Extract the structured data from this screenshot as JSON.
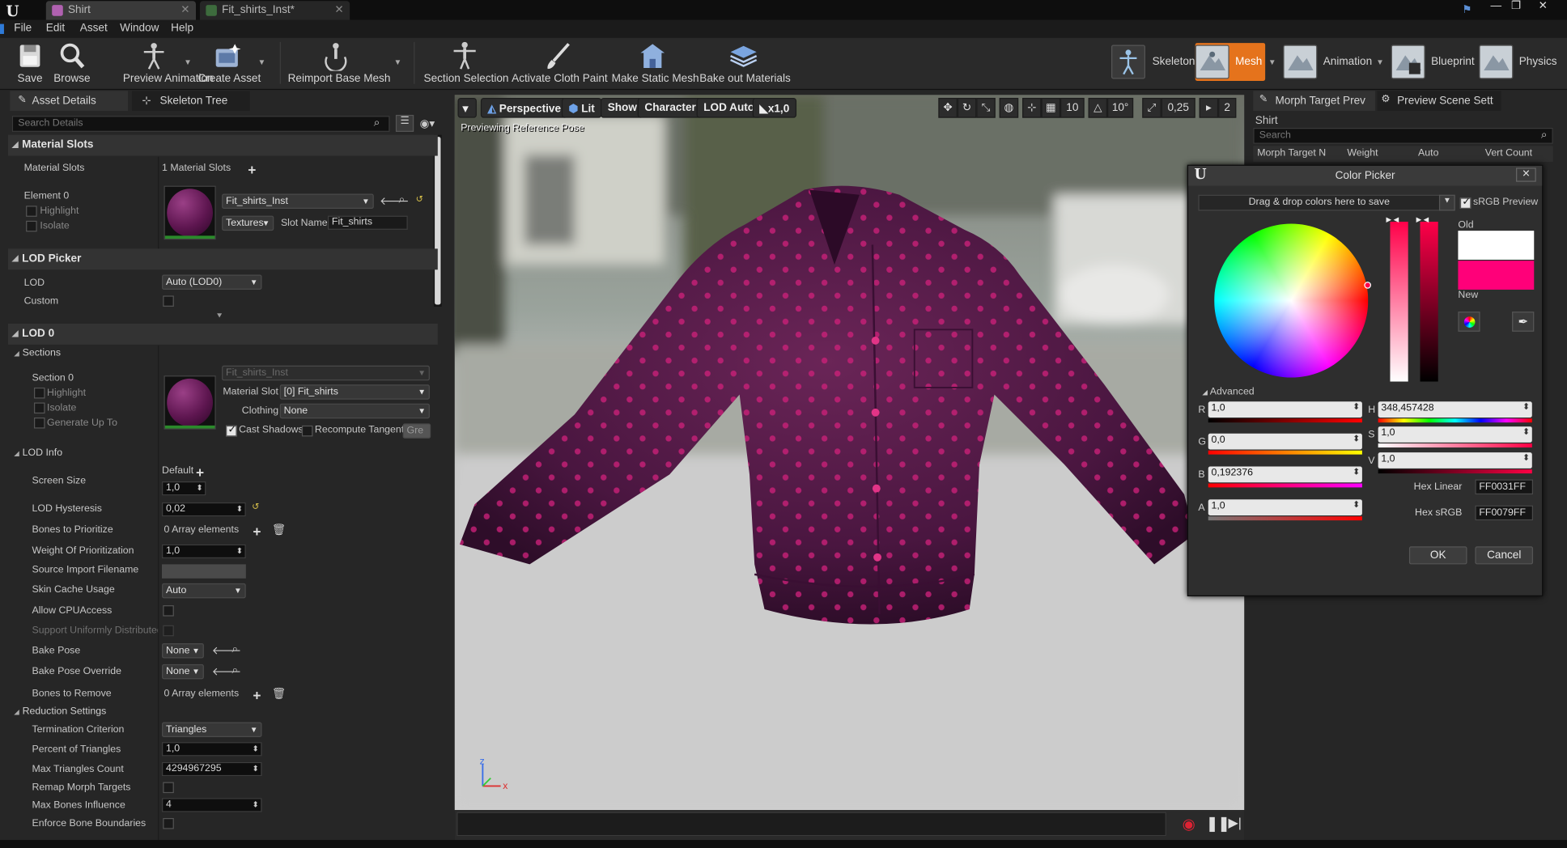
{
  "app": {
    "tabs": [
      {
        "label": "Shirt"
      },
      {
        "label": "Fit_shirts_Inst*"
      }
    ],
    "menu": [
      "File",
      "Edit",
      "Asset",
      "Window",
      "Help"
    ]
  },
  "toolbar": {
    "buttons": [
      {
        "label": "Save",
        "icon": "save-icon"
      },
      {
        "label": "Browse",
        "icon": "browse-icon"
      },
      {
        "label": "Preview Animation",
        "icon": "preview-animation-icon"
      },
      {
        "label": "Create Asset",
        "icon": "create-asset-icon"
      },
      {
        "label": "Reimport Base Mesh",
        "icon": "reimport-icon"
      },
      {
        "label": "Section Selection",
        "icon": "section-selection-icon"
      },
      {
        "label": "Activate Cloth Paint",
        "icon": "cloth-paint-icon"
      },
      {
        "label": "Make Static Mesh",
        "icon": "static-mesh-icon"
      },
      {
        "label": "Bake out Materials",
        "icon": "bake-materials-icon"
      }
    ],
    "modes": [
      {
        "label": "Skeleton",
        "active": false
      },
      {
        "label": "Mesh",
        "active": true
      },
      {
        "label": "Animation",
        "active": false
      },
      {
        "label": "Blueprint",
        "active": false
      },
      {
        "label": "Physics",
        "active": false
      }
    ],
    "active_color": "#e5731c"
  },
  "left_panel": {
    "tabs": [
      "Asset Details",
      "Skeleton Tree"
    ],
    "search_placeholder": "Search Details",
    "material_slots": {
      "header": "Material Slots",
      "label": "Material Slots",
      "count": "1 Material Slots",
      "element": "Element 0",
      "highlight": "Highlight",
      "isolate": "Isolate",
      "material": "Fit_shirts_Inst",
      "textures": "Textures",
      "slot_name_label": "Slot Name",
      "slot_name": "Fit_shirts"
    },
    "lod_picker": {
      "header": "LOD Picker",
      "lod_label": "LOD",
      "lod_value": "Auto (LOD0)",
      "custom_label": "Custom"
    },
    "lod0": {
      "header": "LOD 0",
      "sections": "Sections",
      "section0": "Section 0",
      "highlight": "Highlight",
      "isolate": "Isolate",
      "generate_up_to": "Generate Up To",
      "material_name": "Fit_shirts_Inst",
      "material_slot_label": "Material Slot",
      "material_slot_value": "[0] Fit_shirts",
      "clothing_label": "Clothing",
      "clothing_value": "None",
      "cast_shadows": "Cast Shadows",
      "recompute_tangent": "Recompute Tangent",
      "gre": "Gre"
    },
    "lod_info": {
      "header": "LOD Info",
      "screen_size": "Screen Size",
      "default": "Default",
      "screen_size_value": "1,0",
      "lod_hysteresis": "LOD Hysteresis",
      "lod_hysteresis_value": "0,02",
      "bones_to_prioritize": "Bones to Prioritize",
      "array_elements": "0 Array elements",
      "weight_of_prioritization": "Weight Of Prioritization",
      "weight_value": "1,0",
      "source_import": "Source Import Filename",
      "skin_cache": "Skin Cache Usage",
      "skin_cache_value": "Auto",
      "allow_cpu": "Allow CPUAccess",
      "support_uniformly": "Support Uniformly Distributed S",
      "bake_pose": "Bake Pose",
      "bake_pose_value": "None",
      "bake_pose_override": "Bake Pose Override",
      "bake_pose_override_value": "None",
      "bones_to_remove": "Bones to Remove",
      "bones_to_remove_value": "0 Array elements"
    },
    "reduction": {
      "header": "Reduction Settings",
      "termination": "Termination Criterion",
      "termination_value": "Triangles",
      "percent_triangles": "Percent of Triangles",
      "percent_value": "1,0",
      "max_triangles": "Max Triangles Count",
      "max_triangles_value": "4294967295",
      "remap_morph": "Remap Morph Targets",
      "max_bones": "Max Bones Influence",
      "max_bones_value": "4",
      "enforce_bone": "Enforce Bone Boundaries"
    }
  },
  "viewport": {
    "perspective": "Perspective",
    "lit": "Lit",
    "show": "Show",
    "character": "Character",
    "lod_auto": "LOD Auto",
    "speed": "x1,0",
    "grid_snap": "10",
    "rot_snap": "10°",
    "scale_snap": "0,25",
    "cam_speed": "2",
    "preview_text": "Previewing Reference Pose",
    "shirt_color": "#5a1a4a",
    "dot_color": "#d1237b"
  },
  "right_panel": {
    "tabs": [
      "Morph Target Prev",
      "Preview Scene Sett"
    ],
    "asset_name": "Shirt",
    "search_placeholder": "Search",
    "columns": [
      "Morph Target N",
      "Weight",
      "Auto",
      "Vert Count"
    ]
  },
  "color_picker": {
    "title": "Color Picker",
    "drag_drop": "Drag & drop colors here to save",
    "srgb_preview": "sRGB Preview",
    "old_label": "Old",
    "new_label": "New",
    "old_color": "#ffffff",
    "new_color": "#ff0079",
    "advanced": "Advanced",
    "r_label": "R",
    "r_value": "1,0",
    "g_label": "G",
    "g_value": "0,0",
    "b_label": "B",
    "b_value": "0,192376",
    "a_label": "A",
    "a_value": "1,0",
    "h_label": "H",
    "h_value": "348,457428",
    "s_label": "S",
    "s_value": "1,0",
    "v_label": "V",
    "v_value": "1,0",
    "hex_linear_label": "Hex Linear",
    "hex_linear": "FF0031FF",
    "hex_srgb_label": "Hex sRGB",
    "hex_srgb": "FF0079FF",
    "ok": "OK",
    "cancel": "Cancel"
  }
}
